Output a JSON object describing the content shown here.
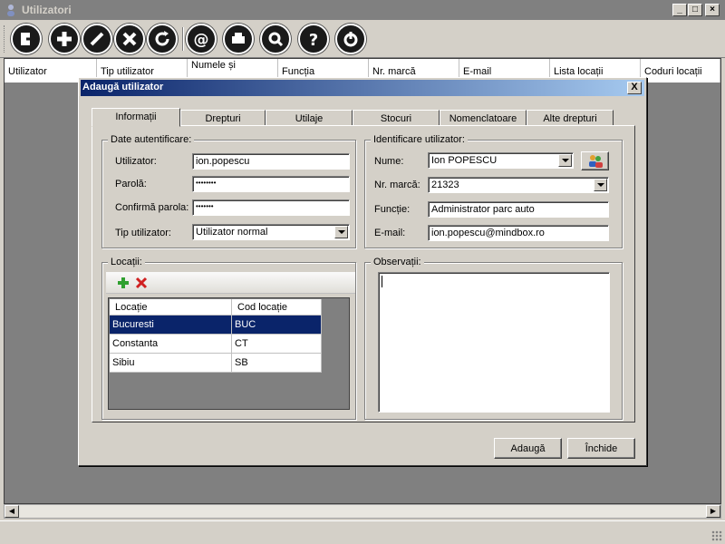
{
  "window": {
    "title": "Utilizatori"
  },
  "toolbar": {
    "buttons": [
      {
        "icon": "exit-icon"
      },
      {
        "icon": "add-icon"
      },
      {
        "icon": "edit-icon"
      },
      {
        "icon": "delete-icon"
      },
      {
        "icon": "refresh-icon"
      },
      {
        "icon": "email-icon"
      },
      {
        "icon": "print-icon"
      },
      {
        "icon": "search-icon"
      },
      {
        "icon": "help-icon"
      },
      {
        "icon": "power-icon"
      }
    ]
  },
  "grid": {
    "columns": [
      "Utilizator",
      "Tip utilizator",
      "Numele și",
      "Funcția",
      "Nr. marcă",
      "E-mail",
      "Lista locații",
      "Coduri locații"
    ]
  },
  "dialog": {
    "title": "Adaugă utilizator",
    "close": "X",
    "tabs": [
      "Informații",
      "Drepturi",
      "Utilaje",
      "Stocuri",
      "Nomenclatoare",
      "Alte drepturi"
    ],
    "auth": {
      "legend": "Date autentificare:",
      "user_label": "Utilizator:",
      "user_value": "ion.popescu",
      "pass_label": "Parolă:",
      "pass_value": "••••••••",
      "confirm_label": "Confirmă parola:",
      "confirm_value": "•••••••",
      "type_label": "Tip utilizator:",
      "type_value": "Utilizator normal"
    },
    "ident": {
      "legend": "Identificare utilizator:",
      "name_label": "Nume:",
      "name_value": "Ion POPESCU",
      "marca_label": "Nr. marcă:",
      "marca_value": "21323",
      "func_label": "Funcție:",
      "func_value": "Administrator parc auto",
      "email_label": "E-mail:",
      "email_value": "ion.popescu@mindbox.ro"
    },
    "locations": {
      "legend": "Locații:",
      "headers": [
        "Locație",
        "Cod locație"
      ],
      "rows": [
        {
          "name": "Bucuresti",
          "code": "BUC"
        },
        {
          "name": "Constanta",
          "code": "CT"
        },
        {
          "name": "Sibiu",
          "code": "SB"
        }
      ]
    },
    "notes": {
      "legend": "Observații:",
      "value": ""
    },
    "add_button": "Adaugă",
    "close_button": "Închide"
  }
}
